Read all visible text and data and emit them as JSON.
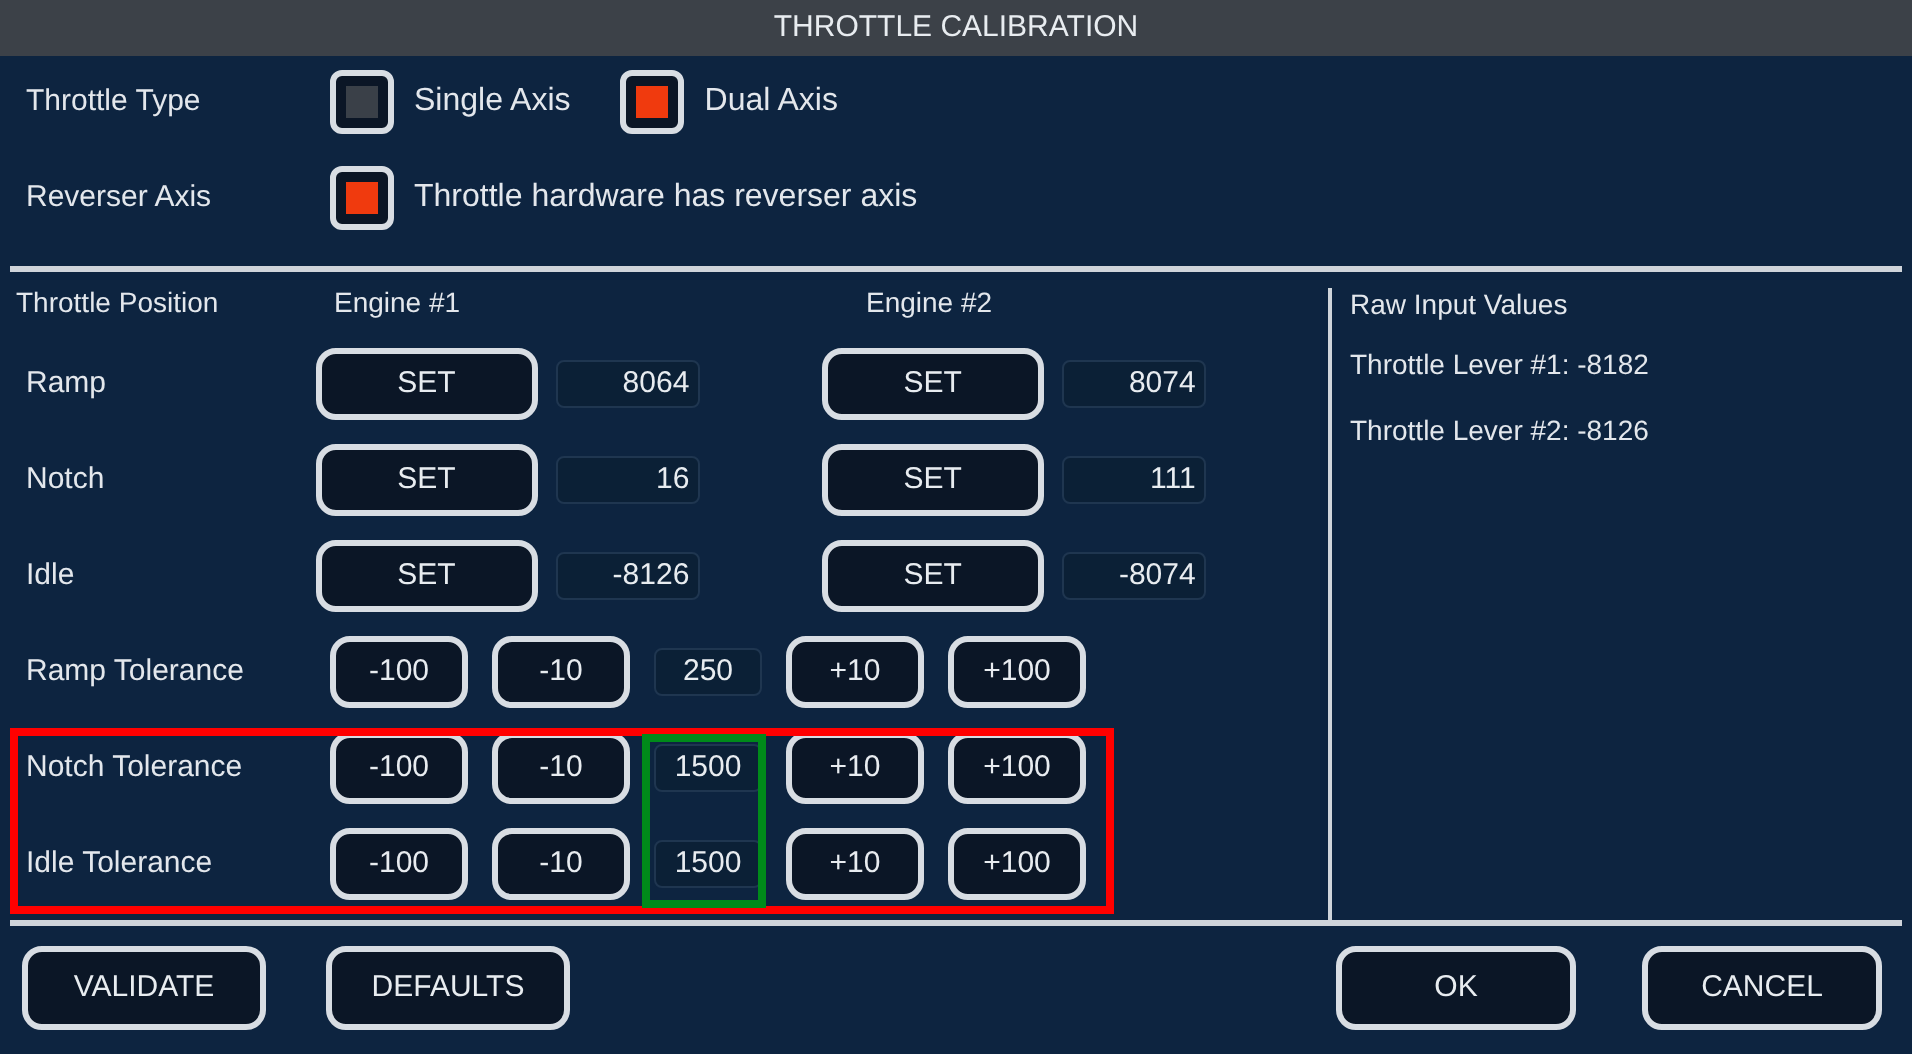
{
  "window": {
    "title": "THROTTLE CALIBRATION"
  },
  "settings": [
    {
      "label": "Throttle Type",
      "options": [
        {
          "label": "Single Axis",
          "checked": false
        },
        {
          "label": "Dual Axis",
          "checked": true
        }
      ]
    },
    {
      "label": "Reverser Axis",
      "options": [
        {
          "label": "Throttle hardware has reverser axis",
          "checked": true
        }
      ]
    }
  ],
  "positions": {
    "header": "Throttle Position",
    "engines": [
      "Engine #1",
      "Engine #2"
    ],
    "rows": [
      {
        "label": "Ramp",
        "engines": [
          {
            "button": "SET",
            "value": "8064"
          },
          {
            "button": "SET",
            "value": "8074"
          }
        ]
      },
      {
        "label": "Notch",
        "engines": [
          {
            "button": "SET",
            "value": "16"
          },
          {
            "button": "SET",
            "value": "111"
          }
        ]
      },
      {
        "label": "Idle",
        "engines": [
          {
            "button": "SET",
            "value": "-8126"
          },
          {
            "button": "SET",
            "value": "-8074"
          }
        ]
      }
    ]
  },
  "tolerances": [
    {
      "label": "Ramp Tolerance",
      "minus": [
        "-100",
        "-10"
      ],
      "value": "250",
      "plus": [
        "+10",
        "+100"
      ],
      "highlighted": false
    },
    {
      "label": "Notch Tolerance",
      "minus": [
        "-100",
        "-10"
      ],
      "value": "1500",
      "plus": [
        "+10",
        "+100"
      ],
      "highlighted": true
    },
    {
      "label": "Idle Tolerance",
      "minus": [
        "-100",
        "-10"
      ],
      "value": "1500",
      "plus": [
        "+10",
        "+100"
      ],
      "highlighted": true
    }
  ],
  "raw_input": {
    "title": "Raw Input Values",
    "lines": [
      "Throttle Lever #1: -8182",
      "Throttle Lever #2: -8126"
    ]
  },
  "footer": {
    "left": [
      "VALIDATE",
      "DEFAULTS"
    ],
    "right": [
      "OK",
      "CANCEL"
    ]
  }
}
